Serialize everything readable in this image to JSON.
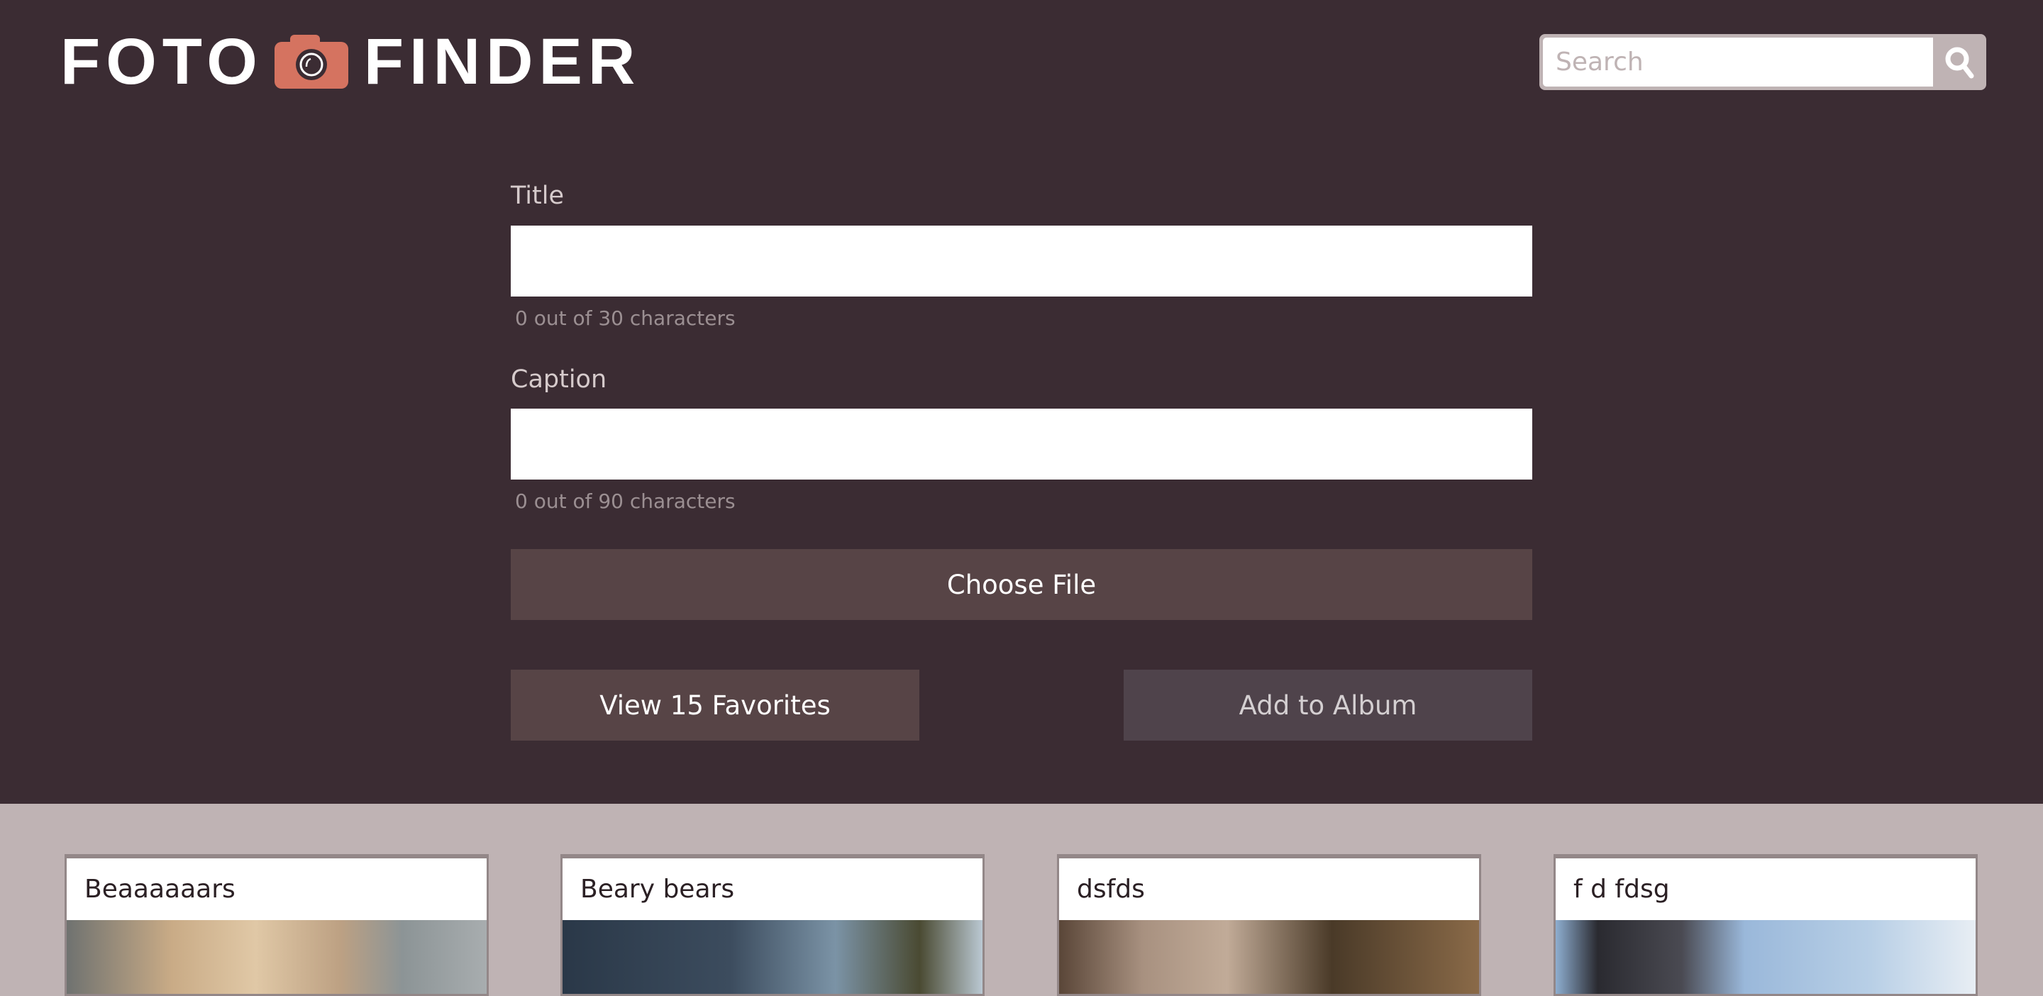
{
  "header": {
    "logo": {
      "left_text": "FOTO",
      "right_text": "FINDER",
      "icon": "camera-icon",
      "icon_color": "#d57360"
    },
    "search": {
      "placeholder": "Search",
      "value": "",
      "icon": "search-icon"
    }
  },
  "form": {
    "title": {
      "label": "Title",
      "value": "",
      "helper": "0 out of 30 characters"
    },
    "caption": {
      "label": "Caption",
      "value": "",
      "helper": "0 out of 90 characters"
    },
    "choose_file_label": "Choose File",
    "view_favorites_label": "View 15 Favorites",
    "add_to_album_label": "Add to Album"
  },
  "cards": [
    {
      "title": "Beaaaaaars"
    },
    {
      "title": "Beary bears"
    },
    {
      "title": "dsfds"
    },
    {
      "title": "f d fdsg"
    }
  ],
  "colors": {
    "header_bg": "#3b2c33",
    "gallery_bg": "#bfb3b4",
    "button": "#574446",
    "accent": "#d57360"
  }
}
